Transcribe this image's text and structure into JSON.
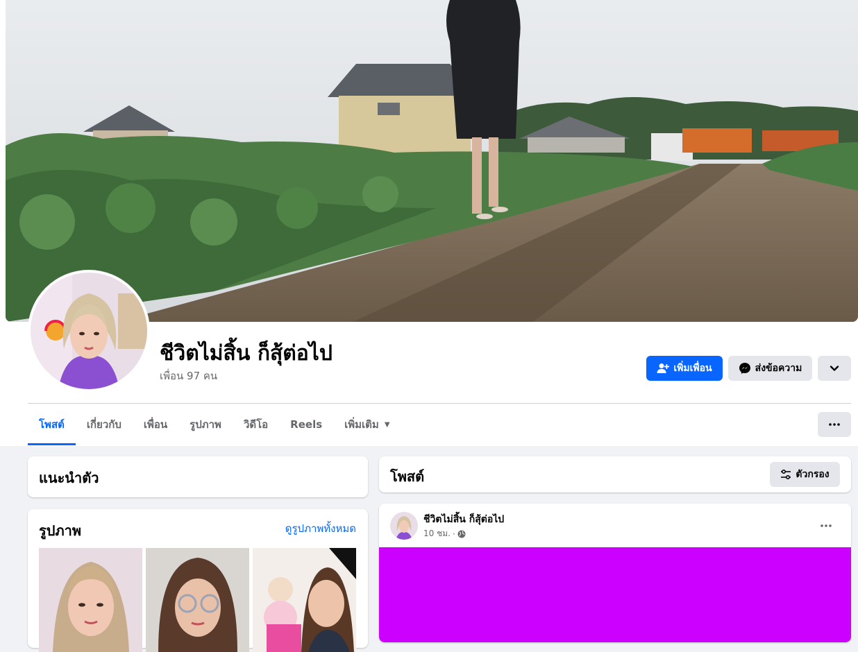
{
  "colors": {
    "accent": "#0866ff",
    "page_background": "#f0f2f5",
    "secondary_button": "#e4e6eb",
    "post_image": "#cc00ff"
  },
  "profile": {
    "name": "ชีวิตไม่สิ้น ก็สุ้ต่อไป",
    "friend_count": "เพื่อน 97 คน"
  },
  "actions": {
    "add_friend": "เพิ่มเพื่อน",
    "add_friend_icon": "person-add-icon",
    "message": "ส่งข้อความ",
    "message_icon": "messenger-icon",
    "more_icon": "chevron-down-icon"
  },
  "tabs": [
    {
      "label": "โพสต์",
      "active": true
    },
    {
      "label": "เกี่ยวกับ",
      "active": false
    },
    {
      "label": "เพื่อน",
      "active": false
    },
    {
      "label": "รูปภาพ",
      "active": false
    },
    {
      "label": "วิดีโอ",
      "active": false
    },
    {
      "label": "Reels",
      "active": false
    },
    {
      "label": "เพิ่มเติม",
      "active": false
    }
  ],
  "intro": {
    "title": "แนะนำตัว"
  },
  "photos": {
    "title": "รูปภาพ",
    "see_all": "ดูรูปภาพทั้งหมด"
  },
  "posts": {
    "title": "โพสต์",
    "filter": "ตัวกรอง",
    "filter_icon": "sliders-icon"
  },
  "post": {
    "author": "ชีวิตไม่สิ้น ก็สุ้ต่อไป",
    "time": "10 ชม.",
    "separator": "·",
    "audience_icon": "globe-icon",
    "menu_icon": "more-horizontal-icon"
  }
}
